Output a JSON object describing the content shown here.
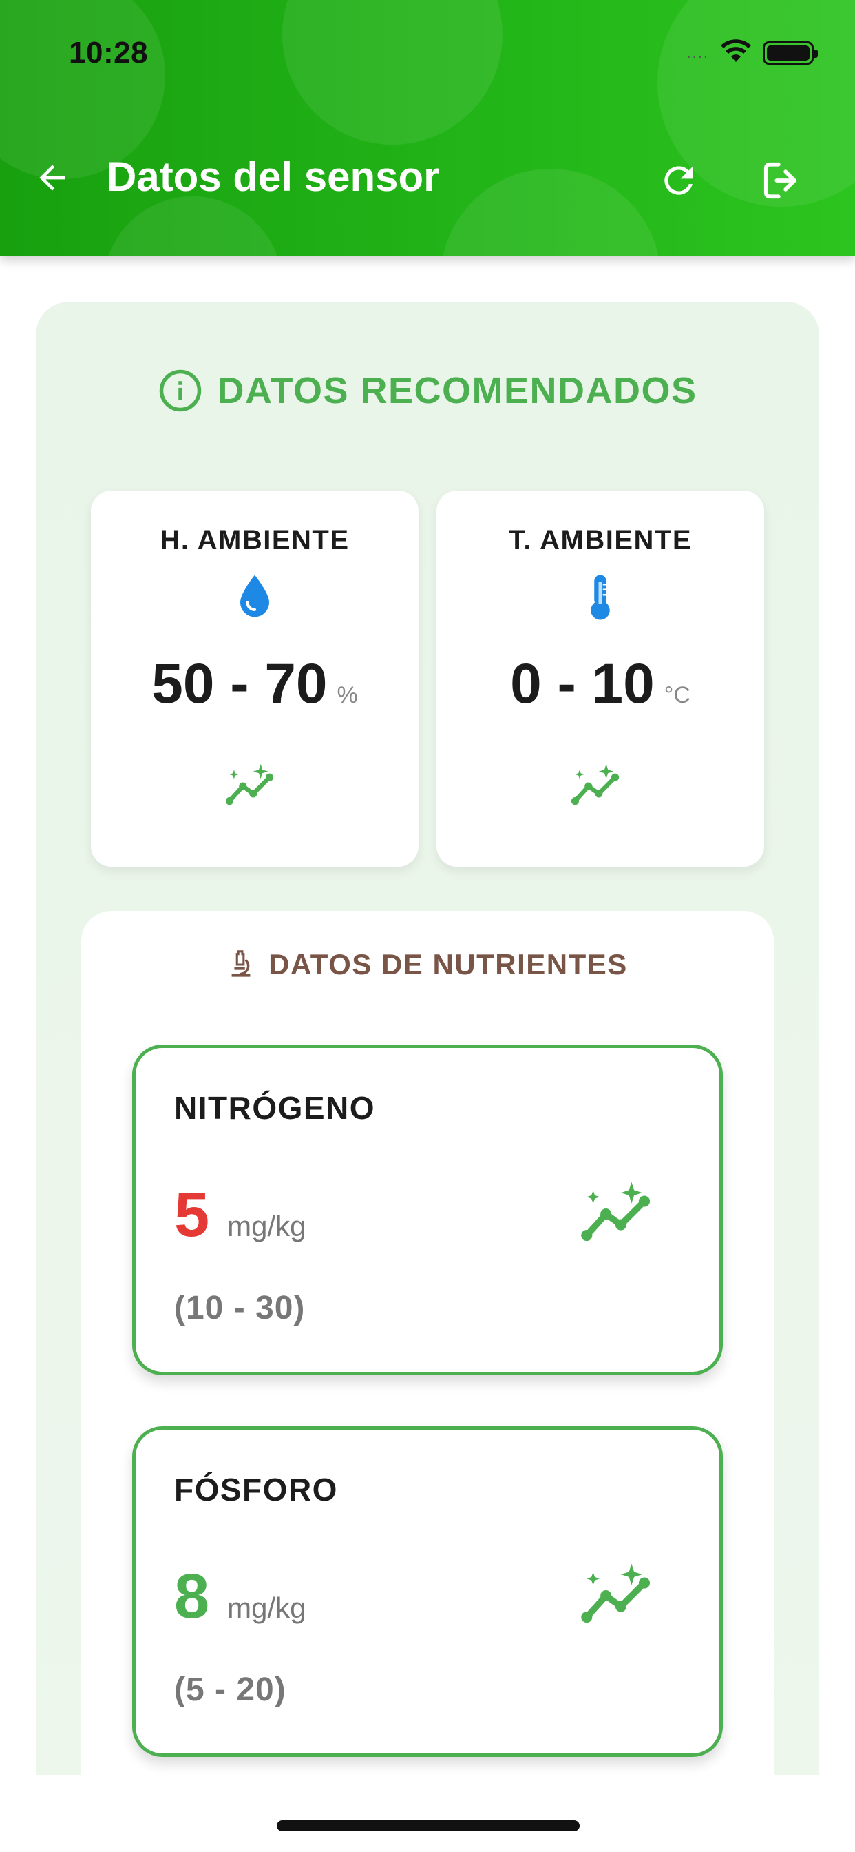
{
  "status_bar": {
    "time": "10:28",
    "signal": "....",
    "wifi_icon": "wifi-icon",
    "battery_icon": "battery-icon"
  },
  "header": {
    "title": "Datos del sensor",
    "back_icon": "arrow-left-icon",
    "refresh_icon": "refresh-icon",
    "logout_icon": "logout-icon"
  },
  "colors": {
    "header_green": "#22b418",
    "accent_green": "#4caf50",
    "alert_red": "#e53935",
    "brown": "#795548",
    "blue": "#1e88e5"
  },
  "recommended": {
    "heading": "DATOS RECOMENDADOS",
    "icon": "info-circle-icon",
    "cards": [
      {
        "label": "H. AMBIENTE",
        "icon": "water-drop-icon",
        "range": "50 - 70",
        "unit": "%",
        "chart_icon": "auto-graph-icon"
      },
      {
        "label": "T. AMBIENTE",
        "icon": "thermometer-icon",
        "range": "0 - 10",
        "unit": "°C",
        "chart_icon": "auto-graph-icon"
      }
    ]
  },
  "nutrients": {
    "heading": "DATOS DE NUTRIENTES",
    "icon": "microscope-icon",
    "items": [
      {
        "name": "NITRÓGENO",
        "value": "5",
        "unit": "mg/kg",
        "range": "(10 - 30)",
        "value_color": "#e53935",
        "chart_icon": "auto-graph-icon"
      },
      {
        "name": "FÓSFORO",
        "value": "8",
        "unit": "mg/kg",
        "range": "(5 - 20)",
        "value_color": "#4caf50",
        "chart_icon": "auto-graph-icon"
      }
    ]
  }
}
